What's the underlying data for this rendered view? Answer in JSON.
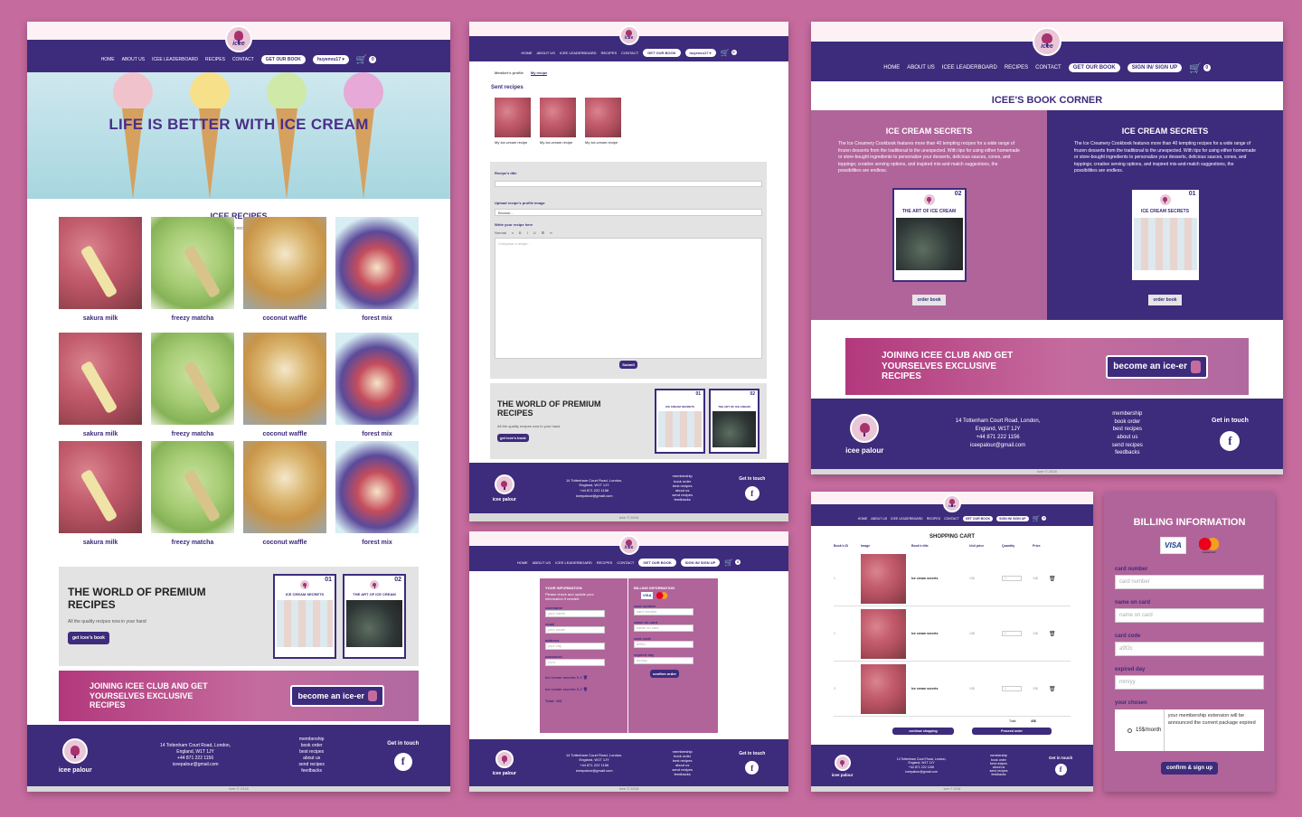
{
  "nav": {
    "home": "HOME",
    "about": "ABOUT US",
    "leaderboard": "ICEE LEADERBOARD",
    "recipes": "RECIPES",
    "contact": "CONTACT",
    "get_book": "GET OUR BOOK",
    "user": "huyenvu17 ▾",
    "signin": "SIGN IN/ SIGN UP",
    "cart_count": "0"
  },
  "logo": {
    "word": "icee"
  },
  "home": {
    "hero_title": "LIFE IS BETTER WITH ICE CREAM",
    "recipes_title": "ICEE RECIPES",
    "recipes_sub": "most favourable recipes just for you",
    "recipe_rows": [
      [
        "sakura milk",
        "freezy matcha",
        "coconut waffle",
        "forest mix"
      ],
      [
        "sakura milk",
        "freezy matcha",
        "coconut waffle",
        "forest mix"
      ],
      [
        "sakura milk",
        "freezy matcha",
        "coconut waffle",
        "forest mix"
      ]
    ],
    "premium_title": "THE WORLD OF PREMIUM RECIPES",
    "premium_sub": "All the quality recipes now in your hand",
    "premium_btn": "get icee's book",
    "join_title": "JOINING ICEE CLUB AND GET YOURSELVES EXCLUSIVE RECIPES",
    "join_btn": "become an ice-er"
  },
  "books": [
    {
      "num": "01",
      "title": "ICE CREAM SECRETS"
    },
    {
      "num": "02",
      "title": "THE ART OF ICE CREAM"
    }
  ],
  "footer": {
    "brand": "icee palour",
    "address": "14 Tottenham Court Road, London, England, W1T 1JY",
    "phone": "+44 871 222 1156",
    "email": "iceepalour@gmail.com",
    "links": [
      "membership",
      "book order",
      "best recipes",
      "about us",
      "send recipes",
      "feedbacks"
    ],
    "touch": "Get in touch",
    "fb": "f",
    "copyright": "icee © 2018"
  },
  "profile": {
    "tabs": [
      "Member's profile",
      "My recipe"
    ],
    "sent_title": "Sent recipes",
    "sent_items": [
      "My Ice-cream recipe",
      "My Ice-cream recipe",
      "My Ice-cream recipe"
    ],
    "recipe_title_label": "Recipe's title",
    "upload_label": "Upload recipe's profile image",
    "browse": "Browse...",
    "write_label": "Write your recipe here",
    "editor_tools": [
      "Normal",
      "x",
      "B",
      "I",
      "U",
      "⊞",
      "∞"
    ],
    "editor_placeholder": "Compose a recipe...",
    "submit": "Submit"
  },
  "checkout_form": {
    "info_title": "YOUR INFORMATION",
    "info_sub": "Please check and update your information if needed",
    "fields": [
      {
        "label": "username",
        "ph": "your name"
      },
      {
        "label": "email",
        "ph": "your email"
      },
      {
        "label": "address",
        "ph": "your city"
      },
      {
        "label": "password",
        "ph": "••••••"
      }
    ],
    "items": [
      "Ice cream secrets X 2",
      "Ice cream secrets X 2"
    ],
    "total": "Total: 20$",
    "billing_title": "BILLING INFORMATION",
    "billing_fields": [
      {
        "label": "card number",
        "ph": "card number"
      },
      {
        "label": "name on card",
        "ph": "name on card"
      },
      {
        "label": "card code",
        "ph": "a9f2c"
      },
      {
        "label": "expired day",
        "ph": "mm/yy"
      }
    ],
    "confirm": "confirm order"
  },
  "bookcorner": {
    "title": "ICEE'S BOOK CORNER",
    "cols": [
      {
        "heading": "ICE CREAM SECRETS",
        "text": "The Ice Creamery Cookbook features more than 40 tempting recipes for a wide range of frozen desserts from the traditional to the unexpected. With tips for using either homemade or store-bought ingredients to personalize your desserts, delicious sauces, cones, and toppings; creative serving options, and inspired mix-and-match suggestions, the possibilities are endless.",
        "book_num": "02",
        "book_title": "THE ART OF ICE CREAM",
        "btn": "order book"
      },
      {
        "heading": "ICE CREAM SECRETS",
        "text": "The Ice Creamery Cookbook features more than 40 tempting recipes for a wide range of frozen desserts from the traditional to the unexpected. With tips for using either homemade or store-bought ingredients to personalize your desserts, delicious sauces, cones, and toppings; creative serving options, and inspired mix-and-match suggestions, the possibilities are endless.",
        "book_num": "01",
        "book_title": "ICE CREAM SECRETS",
        "btn": "order book"
      }
    ]
  },
  "cart": {
    "title": "SHOPPING CART",
    "headers": [
      "Book's ID",
      "Image",
      "Book's title",
      "Unit price",
      "Quantity",
      "Price"
    ],
    "rows": [
      {
        "id": "1",
        "title": "Ice cream secrets",
        "unit": "10$",
        "qty": "1",
        "price": "10$"
      },
      {
        "id": "2",
        "title": "Ice cream secrets",
        "unit": "10$",
        "qty": "1",
        "price": "10$"
      },
      {
        "id": "3",
        "title": "Ice cream secrets",
        "unit": "10$",
        "qty": "1",
        "price": "10$"
      }
    ],
    "total_label": "Total",
    "total_value": "40$",
    "continue": "continue shopping",
    "proceed": "Proceed order"
  },
  "billing": {
    "title": "BILLING INFORMATION",
    "visa": "VISA",
    "mc": "mastercard",
    "fields": [
      {
        "label": "card number",
        "ph": "card number"
      },
      {
        "label": "name on card",
        "ph": "name on card"
      },
      {
        "label": "card code",
        "ph": "a9f2c"
      },
      {
        "label": "expired day",
        "ph": "mm/yy"
      }
    ],
    "chosen_label": "your chosen",
    "plan": "15$/month",
    "plan_note": "your membership extension will be announced the current package expired",
    "btn": "confirm & sign up"
  }
}
